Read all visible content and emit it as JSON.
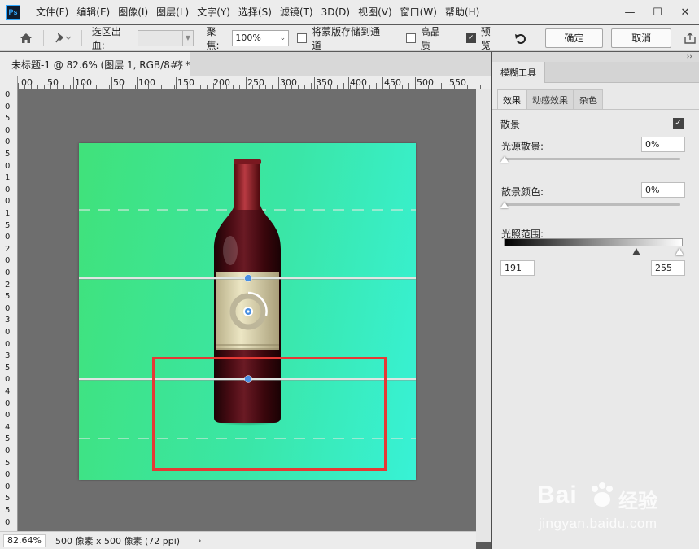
{
  "app": {
    "logo_text": "Ps",
    "menu": [
      "文件(F)",
      "编辑(E)",
      "图像(I)",
      "图层(L)",
      "文字(Y)",
      "选择(S)",
      "滤镜(T)",
      "3D(D)",
      "视图(V)",
      "窗口(W)",
      "帮助(H)"
    ]
  },
  "options": {
    "selection_bleed_label": "选区出血:",
    "focus_label": "聚焦:",
    "focus_value": "100%",
    "save_mask_label": "将蒙版存储到通道",
    "save_mask_checked": false,
    "high_quality_label": "高品质",
    "high_quality_checked": false,
    "preview_label": "预览",
    "preview_checked": true,
    "ok_label": "确定",
    "cancel_label": "取消"
  },
  "document": {
    "tab_title": "未标题-1 @ 82.6% (图层 1, RGB/8#) *",
    "zoom": "82.64%",
    "size_info": "500 像素 x 500 像素 (72 ppi)",
    "ruler_h_labels": [
      "00",
      "50",
      "100",
      "50",
      "100",
      "150",
      "200",
      "250",
      "300",
      "350",
      "400",
      "450",
      "500",
      "550"
    ],
    "ruler_v_labels": [
      "0",
      "0",
      "5",
      "0",
      "0",
      "5",
      "0",
      "1",
      "0",
      "0",
      "1",
      "5",
      "0",
      "2",
      "0",
      "0",
      "2",
      "5",
      "0",
      "3",
      "0",
      "0",
      "3",
      "5",
      "0",
      "4",
      "0",
      "0",
      "4",
      "5",
      "0",
      "5",
      "0",
      "0",
      "5",
      "5",
      "0"
    ]
  },
  "panel": {
    "title": "模糊工具",
    "tabs": [
      "效果",
      "动感效果",
      "杂色"
    ],
    "active_tab": 0,
    "bokeh_label": "散景",
    "bokeh_checked": true,
    "light_bokeh_label": "光源散景:",
    "light_bokeh_value": "0%",
    "bokeh_color_label": "散景颜色:",
    "bokeh_color_value": "0%",
    "light_range_label": "光照范围:",
    "light_range_min": "191",
    "light_range_max": "255"
  },
  "watermark": {
    "brand": "Bai",
    "brand_suffix": "经验",
    "url": "jingyan.baidu.com"
  },
  "colors": {
    "selection_rect": "#e53935",
    "pin": "#4a90e2",
    "accent_blue": "#31a8ff"
  }
}
